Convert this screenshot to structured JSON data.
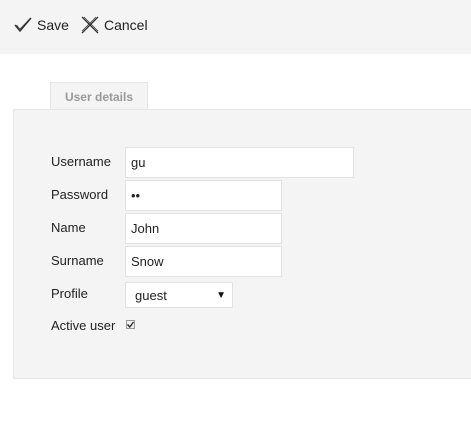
{
  "toolbar": {
    "save_label": "Save",
    "cancel_label": "Cancel",
    "save_icon": "checkmark-icon",
    "cancel_icon": "x-cross-icon"
  },
  "tabs": [
    {
      "label": "User details"
    }
  ],
  "form": {
    "username_label": "Username",
    "username_value": "gu",
    "password_label": "Password",
    "password_value": "••",
    "name_label": "Name",
    "name_value": "John",
    "surname_label": "Surname",
    "surname_value": "Snow",
    "profile_label": "Profile",
    "profile_value": "guest",
    "active_label": "Active user",
    "active_checked": true
  }
}
